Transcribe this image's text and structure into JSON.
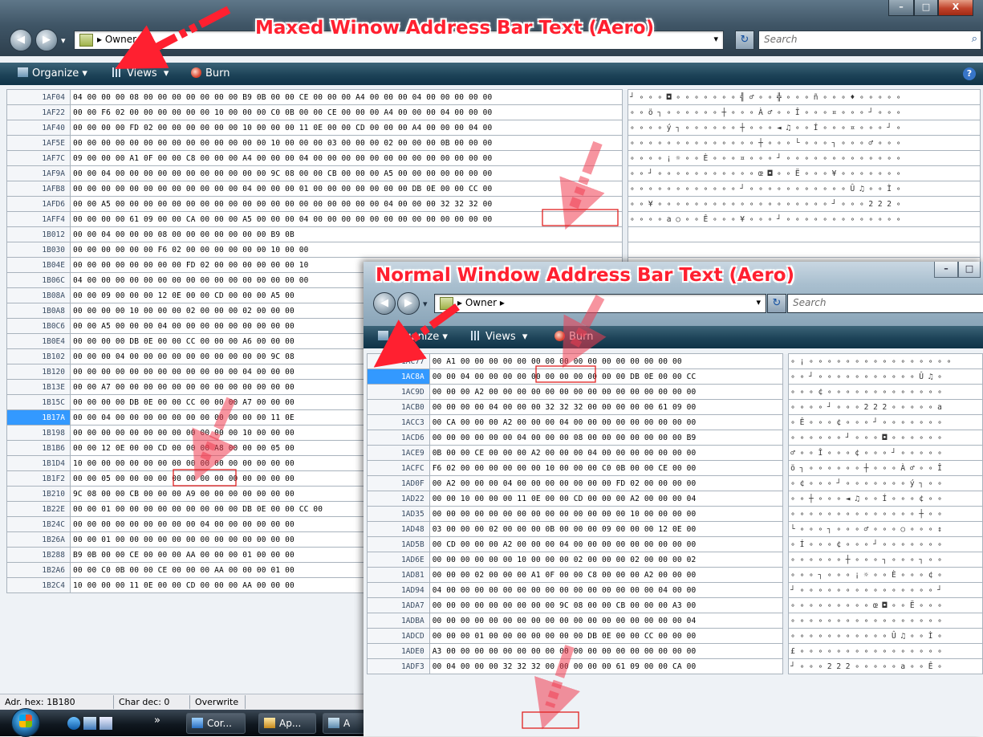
{
  "annotations": {
    "top": "Maxed Winow Address Bar Text (Aero)",
    "bottom": "Normal Window Address Bar Text (Aero)"
  },
  "icons": [
    "back-arrow-icon",
    "forward-arrow-icon",
    "folder-icon",
    "breadcrumb-arrow-icon",
    "refresh-icon",
    "search-icon",
    "organize-icon",
    "views-icon",
    "burn-icon",
    "help-icon",
    "minimize-icon",
    "maximize-icon",
    "close-icon",
    "start-orb-icon"
  ],
  "colors": {
    "annotation": "#ff2030",
    "selection": "#3399ff",
    "highlight_box": "#e02020"
  },
  "window1": {
    "address": "Owner",
    "search_placeholder": "Search",
    "toolbar": {
      "organize": "Organize",
      "views": "Views",
      "burn": "Burn",
      "help": "?"
    },
    "caption": {
      "minimize": "–",
      "maximize": "□",
      "close": "X"
    },
    "rows": [
      {
        "off": "1AF04",
        "bytes": "04 00 00 00 08 00 00 00 00 00 00 00 B9 0B 00 00 CE 00 00 00 A4 00 00 00 04 00 00 00 00 00",
        "chars": "┘ ∘ ∘ ∘ ◘ ∘ ∘ ∘ ∘ ∘ ∘ ∘ ╣ ♂ ∘ ∘ ╬ ∘ ∘ ∘ ñ ∘ ∘ ∘ ♦ ∘ ∘ ∘ ∘ ∘"
      },
      {
        "off": "1AF22",
        "bytes": "00 00 F6 02 00 00 00 00 00 00 10 00 00 00 C0 0B 00 00 CE 00 00 00 A4 00 00 00 04 00 00 00",
        "chars": "∘ ∘ ö ┐ ∘ ∘ ∘ ∘ ∘ ∘ ┼ ∘ ∘ ∘ À ♂ ∘ ∘ Î ∘ ∘ ∘ ¤ ∘ ∘ ∘ ┘ ∘ ∘ ∘"
      },
      {
        "off": "1AF40",
        "bytes": "00 00 00 00 FD 02 00 00 00 00 00 00 10 00 00 00 11 0E 00 00 CD 00 00 00 A4 00 00 00 04 00",
        "chars": "∘ ∘ ∘ ∘ ý ┐ ∘ ∘ ∘ ∘ ∘ ∘ ┼ ∘ ∘ ∘ ◄ ♫ ∘ ∘ Í ∘ ∘ ∘ ¤ ∘ ∘ ∘ ┘ ∘"
      },
      {
        "off": "1AF5E",
        "bytes": "00 00 00 00 00 00 00 00 00 00 00 00 00 00 10 00 00 00 03 00 00 00 02 00 00 00 0B 00 00 00",
        "chars": "∘ ∘ ∘ ∘ ∘ ∘ ∘ ∘ ∘ ∘ ∘ ∘ ∘ ∘ ┼ ∘ ∘ ∘ └ ∘ ∘ ∘ ┐ ∘ ∘ ∘ ♂ ∘ ∘ ∘"
      },
      {
        "off": "1AF7C",
        "bytes": "09 00 00 00 A1 0F 00 00 C8 00 00 00 A4 00 00 00 04 00 00 00 00 00 00 00 00 00 00 00 00 00",
        "chars": "∘ ∘ ∘ ∘ ¡ ☼ ∘ ∘ È ∘ ∘ ∘ ¤ ∘ ∘ ∘ ┘ ∘ ∘ ∘ ∘ ∘ ∘ ∘ ∘ ∘ ∘ ∘ ∘ ∘"
      },
      {
        "off": "1AF9A",
        "bytes": "00 00 04 00 00 00 00 00 00 00 00 00 00 00 9C 08 00 00 CB 00 00 00 A5 00 00 00 00 00 00 00",
        "chars": "∘ ∘ ┘ ∘ ∘ ∘ ∘ ∘ ∘ ∘ ∘ ∘ ∘ ∘ œ ◘ ∘ ∘ Ë ∘ ∘ ∘ ¥ ∘ ∘ ∘ ∘ ∘ ∘ ∘"
      },
      {
        "off": "1AFB8",
        "bytes": "00 00 00 00 00 00 00 00 00 00 00 00 04 00 00 00 01 00 00 00 00 00 00 00 DB 0E 00 00 CC 00",
        "chars": "∘ ∘ ∘ ∘ ∘ ∘ ∘ ∘ ∘ ∘ ∘ ∘ ┘ ∘ ∘ ∘ ∘ ∘ ∘ ∘ ∘ ∘ ∘ ∘ Û ♫ ∘ ∘ Ì ∘"
      },
      {
        "off": "1AFD6",
        "bytes": "00 00 A5 00 00 00 00 00 00 00 00 00 00 00 00 00 00 00 00 00 00 00 04 00 00 00 32 32 32 00",
        "chars": "∘ ∘ ¥ ∘ ∘ ∘ ∘ ∘ ∘ ∘ ∘ ∘ ∘ ∘ ∘ ∘ ∘ ∘ ∘ ∘ ∘ ∘ ┘ ∘ ∘ ∘ 2 2 2 ∘"
      },
      {
        "off": "1AFF4",
        "bytes": "00 00 00 00 61 09 00 00 CA 00 00 00 A5 00 00 00 04 00 00 00 00 00 00 00 00 00 00 00 00 00",
        "chars": "∘ ∘ ∘ ∘ a ○ ∘ ∘ Ê ∘ ∘ ∘ ¥ ∘ ∘ ∘ ┘ ∘ ∘ ∘ ∘ ∘ ∘ ∘ ∘ ∘ ∘ ∘ ∘ ∘"
      },
      {
        "off": "1B012",
        "bytes": "00 00 04 00 00 00 08 00 00 00 00 00 00 00 B9 0B",
        "chars": ""
      },
      {
        "off": "1B030",
        "bytes": "00 00 00 00 00 00 F6 02 00 00 00 00 00 00 10 00 00",
        "chars": ""
      },
      {
        "off": "1B04E",
        "bytes": "00 00 00 00 00 00 00 00 FD 02 00 00 00 00 00 00 10",
        "chars": ""
      },
      {
        "off": "1B06C",
        "bytes": "04 00 00 00 00 00 00 00 00 00 00 00 00 00 00 00 00",
        "chars": ""
      },
      {
        "off": "1B08A",
        "bytes": "00 00 09 00 00 00 12 0E 00 00 CD 00 00 00 A5 00",
        "chars": ""
      },
      {
        "off": "1B0A8",
        "bytes": "00 00 00 00 10 00 00 00 02 00 00 00 02 00 00 00",
        "chars": ""
      },
      {
        "off": "1B0C6",
        "bytes": "00 00 A5 00 00 00 04 00 00 00 00 00 00 00 00 00",
        "chars": ""
      },
      {
        "off": "1B0E4",
        "bytes": "00 00 00 00 DB 0E 00 00 CC 00 00 00 A6 00 00 00",
        "chars": ""
      },
      {
        "off": "1B102",
        "bytes": "00 00 00 04 00 00 00 00 00 00 00 00 00 00 9C 08",
        "chars": ""
      },
      {
        "off": "1B120",
        "bytes": "00 00 00 00 00 00 00 00 00 00 00 00 04 00 00 00",
        "chars": ""
      },
      {
        "off": "1B13E",
        "bytes": "00 00 A7 00 00 00 00 00 00 00 00 00 00 00 00 00",
        "chars": ""
      },
      {
        "off": "1B15C",
        "bytes": "00 00 00 00 DB 0E 00 00 CC 00 00 00 A7 00 00 00",
        "chars": ""
      },
      {
        "off": "1B17A",
        "bytes": "00 00 04 00 00 00 00 00 00 00 00 00 00 00 11 0E",
        "chars": ""
      },
      {
        "off": "1B198",
        "bytes": "00 00 00 00 00 00 00 00 00 00 00 00 10 00 00 00",
        "chars": ""
      },
      {
        "off": "1B1B6",
        "bytes": "00 00 12 0E 00 00 CD 00 00 00 A8 00 00 00 05 00",
        "chars": ""
      },
      {
        "off": "1B1D4",
        "bytes": "10 00 00 00 00 00 00 00 00 00 00 00 00 00 00 00",
        "chars": ""
      },
      {
        "off": "1B1F2",
        "bytes": "00 00 05 00 00 00 00 00 00 00 00 00 00 00 00 00",
        "chars": ""
      },
      {
        "off": "1B210",
        "bytes": "9C 08 00 00 CB 00 00 00 A9 00 00 00 00 00 00 00",
        "chars": ""
      },
      {
        "off": "1B22E",
        "bytes": "00 00 01 00 00 00 00 00 00 00 00 00 DB 0E 00 00 CC 00",
        "chars": ""
      },
      {
        "off": "1B24C",
        "bytes": "00 00 00 00 00 00 00 00 00 04 00 00 00 00 00 00",
        "chars": ""
      },
      {
        "off": "1B26A",
        "bytes": "00 00 01 00 00 00 00 00 00 00 00 00 00 00 00 00",
        "chars": ""
      },
      {
        "off": "1B288",
        "bytes": "B9 0B 00 00 CE 00 00 00 AA 00 00 00 01 00 00 00",
        "chars": ""
      },
      {
        "off": "1B2A6",
        "bytes": "00 00 C0 0B 00 00 CE 00 00 00 AA 00 00 00 01 00",
        "chars": ""
      },
      {
        "off": "1B2C4",
        "bytes": "10 00 00 00 11 0E 00 00 CD 00 00 00 AA 00 00 00",
        "chars": ""
      }
    ],
    "selected_offset": "1B17A",
    "status": {
      "addr": "Adr. hex: 1B180",
      "char": "Char dec: 0",
      "mode": "Overwrite"
    },
    "taskbar": {
      "more": "»",
      "btn1": "Cor...",
      "btn2": "Ap...",
      "btn3": "A"
    }
  },
  "window2": {
    "address": "Owner",
    "search_placeholder": "Search",
    "toolbar": {
      "organize": "Organize",
      "views": "Views",
      "burn": "Burn"
    },
    "caption": {
      "minimize": "–",
      "maximize": "□"
    },
    "rows": [
      {
        "off": "1AC77",
        "bytes": "00 A1 00 00 00 00 00 00 00 00 00 00 00 00 00 00 00 00",
        "chars": "∘ ¡ ∘ ∘ ∘ ∘ ∘ ∘ ∘ ∘ ∘ ∘ ∘ ∘ ∘ ∘ ∘ ∘"
      },
      {
        "off": "1AC8A",
        "bytes": "00 00 04 00 00 00 00 00 00 00 00 00 00 00 DB 0E 00 00 CC",
        "chars": "∘ ∘ ┘ ∘ ∘ ∘ ∘ ∘ ∘ ∘ ∘ ∘ ∘ ∘ Û ♫ ∘"
      },
      {
        "off": "1AC9D",
        "bytes": "00 00 00 A2 00 00 00 00 00 00 00 00 00 00 00 00 00 00 00",
        "chars": "∘ ∘ ∘ ¢ ∘ ∘ ∘ ∘ ∘ ∘ ∘ ∘ ∘ ∘ ∘ ∘ ∘"
      },
      {
        "off": "1ACB0",
        "bytes": "00 00 00 00 04 00 00 00 32 32 32 00 00 00 00 00 61 09 00",
        "chars": "∘ ∘ ∘ ∘ ┘ ∘ ∘ ∘ 2 2 2 ∘ ∘ ∘ ∘ ∘ a"
      },
      {
        "off": "1ACC3",
        "bytes": "00 CA 00 00 00 A2 00 00 00 04 00 00 00 00 00 00 00 00 00",
        "chars": "∘ Ê ∘ ∘ ∘ ¢ ∘ ∘ ∘ ┘ ∘ ∘ ∘ ∘ ∘ ∘ ∘"
      },
      {
        "off": "1ACD6",
        "bytes": "00 00 00 00 00 00 04 00 00 00 08 00 00 00 00 00 00 00 B9",
        "chars": "∘ ∘ ∘ ∘ ∘ ∘ ┘ ∘ ∘ ∘ ◘ ∘ ∘ ∘ ∘ ∘ ∘"
      },
      {
        "off": "1ACE9",
        "bytes": "0B 00 00 CE 00 00 00 A2 00 00 00 04 00 00 00 00 00 00 00",
        "chars": "♂ ∘ ∘ Î ∘ ∘ ∘ ¢ ∘ ∘ ∘ ┘ ∘ ∘ ∘ ∘ ∘"
      },
      {
        "off": "1ACFC",
        "bytes": "F6 02 00 00 00 00 00 00 10 00 00 00 C0 0B 00 00 CE 00 00",
        "chars": "ö ┐ ∘ ∘ ∘ ∘ ∘ ∘ ┼ ∘ ∘ ∘ À ♂ ∘ ∘ Î"
      },
      {
        "off": "1AD0F",
        "bytes": "00 A2 00 00 00 04 00 00 00 00 00 00 00 FD 02 00 00 00 00",
        "chars": "∘ ¢ ∘ ∘ ∘ ┘ ∘ ∘ ∘ ∘ ∘ ∘ ∘ ý ┐ ∘ ∘"
      },
      {
        "off": "1AD22",
        "bytes": "00 00 10 00 00 00 11 0E 00 00 CD 00 00 00 A2 00 00 00 04",
        "chars": "∘ ∘ ┼ ∘ ∘ ∘ ◄ ♫ ∘ ∘ Í ∘ ∘ ∘ ¢ ∘ ∘"
      },
      {
        "off": "1AD35",
        "bytes": "00 00 00 00 00 00 00 00 00 00 00 00 00 00 10 00 00 00 00",
        "chars": "∘ ∘ ∘ ∘ ∘ ∘ ∘ ∘ ∘ ∘ ∘ ∘ ∘ ∘ ┼ ∘ ∘"
      },
      {
        "off": "1AD48",
        "bytes": "03 00 00 00 02 00 00 00 0B 00 00 00 09 00 00 00 12 0E 00",
        "chars": "└ ∘ ∘ ∘ ┐ ∘ ∘ ∘ ♂ ∘ ∘ ∘ ○ ∘ ∘ ∘ ↕"
      },
      {
        "off": "1AD5B",
        "bytes": "00 CD 00 00 00 A2 00 00 00 04 00 00 00 00 00 00 00 00 00",
        "chars": "∘ Í ∘ ∘ ∘ ¢ ∘ ∘ ∘ ┘ ∘ ∘ ∘ ∘ ∘ ∘ ∘"
      },
      {
        "off": "1AD6E",
        "bytes": "00 00 00 00 00 00 10 00 00 00 02 00 00 00 02 00 00 00 02",
        "chars": "∘ ∘ ∘ ∘ ∘ ∘ ┼ ∘ ∘ ∘ ┐ ∘ ∘ ∘ ┐ ∘ ∘"
      },
      {
        "off": "1AD81",
        "bytes": "00 00 00 02 00 00 00 A1 0F 00 00 C8 00 00 00 A2 00 00 00",
        "chars": "∘ ∘ ∘ ┐ ∘ ∘ ∘ ¡ ☼ ∘ ∘ È ∘ ∘ ∘ ¢ ∘"
      },
      {
        "off": "1AD94",
        "bytes": "04 00 00 00 00 00 00 00 00 00 00 00 00 00 00 00 04 00 00",
        "chars": "┘ ∘ ∘ ∘ ∘ ∘ ∘ ∘ ∘ ∘ ∘ ∘ ∘ ∘ ∘ ∘ ┘"
      },
      {
        "off": "1ADA7",
        "bytes": "00 00 00 00 00 00 00 00 00 9C 08 00 00 CB 00 00 00 A3 00",
        "chars": "∘ ∘ ∘ ∘ ∘ ∘ ∘ ∘ ∘ œ ◘ ∘ ∘ Ë ∘ ∘ ∘"
      },
      {
        "off": "1ADBA",
        "bytes": "00 00 00 00 00 00 00 00 00 00 00 00 00 00 00 00 00 00 04",
        "chars": "∘ ∘ ∘ ∘ ∘ ∘ ∘ ∘ ∘ ∘ ∘ ∘ ∘ ∘ ∘ ∘ ∘"
      },
      {
        "off": "1ADCD",
        "bytes": "00 00 00 01 00 00 00 00 00 00 00 DB 0E 00 00 CC 00 00 00",
        "chars": "∘ ∘ ∘ ∘ ∘ ∘ ∘ ∘ ∘ ∘ ∘ Û ♫ ∘ ∘ Ì ∘"
      },
      {
        "off": "1ADE0",
        "bytes": "A3 00 00 00 00 00 00 00 00 00 00 00 00 00 00 00 00 00 00",
        "chars": "£ ∘ ∘ ∘ ∘ ∘ ∘ ∘ ∘ ∘ ∘ ∘ ∘ ∘ ∘ ∘ ∘"
      },
      {
        "off": "1ADF3",
        "bytes": "00 04 00 00 00 32 32 32 00 00 00 00 00 61 09 00 00 CA 00",
        "chars": "┘ ∘ ∘ ∘ 2 2 2 ∘ ∘ ∘ ∘ ∘ a ∘ ∘ Ê ∘"
      }
    ],
    "selected_offset": "1AC8A"
  }
}
